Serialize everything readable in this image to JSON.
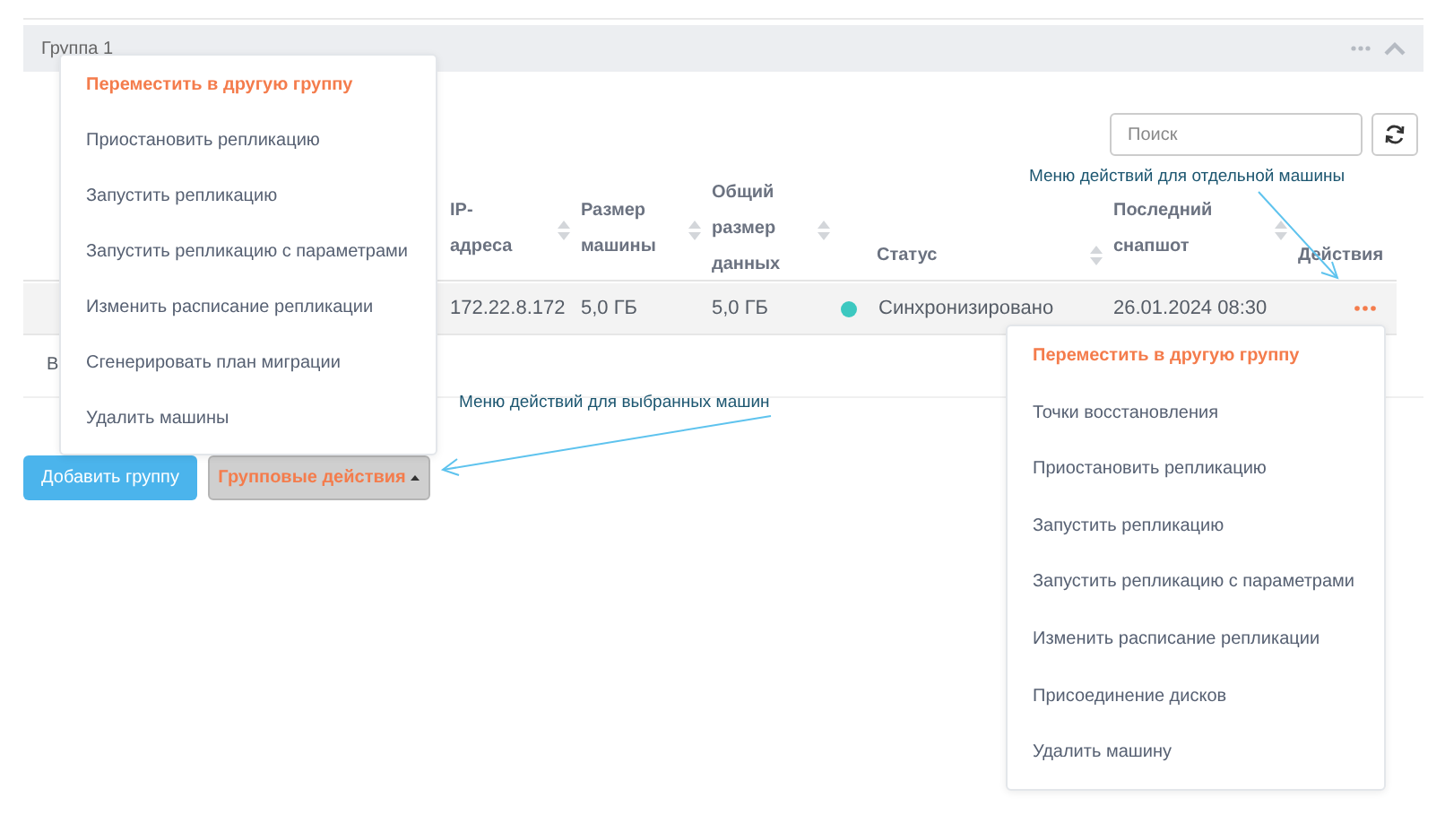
{
  "group": {
    "title": "Группа 1"
  },
  "search": {
    "placeholder": "Поиск"
  },
  "table": {
    "columns": [
      {
        "label": "IP-адреса",
        "sortable": true
      },
      {
        "label": "Размер машины",
        "sortable": true
      },
      {
        "label": "Общий размер данных",
        "sortable": true
      },
      {
        "label": "Статус",
        "sortable": true
      },
      {
        "label": "Последний снапшот",
        "sortable": true
      },
      {
        "label": "Действия",
        "sortable": false
      }
    ],
    "rows": [
      {
        "ip": "172.22.8.172",
        "size": "5,0 ГБ",
        "total": "5,0 ГБ",
        "status": "Синхронизировано",
        "color": "#3cc8c0",
        "snapshot": "26.01.2024 08:30"
      }
    ]
  },
  "below_text": "В",
  "buttons": {
    "add_group": "Добавить группу",
    "group_actions": "Групповые действия"
  },
  "group_actions_menu": [
    {
      "label": "Переместить в другую группу",
      "selected": true
    },
    {
      "label": "Приостановить репликацию",
      "selected": false
    },
    {
      "label": "Запустить репликацию",
      "selected": false
    },
    {
      "label": "Запустить репликацию с параметрами",
      "selected": false
    },
    {
      "label": "Изменить расписание репликации",
      "selected": false
    },
    {
      "label": "Сгенерировать план миграции",
      "selected": false
    },
    {
      "label": "Удалить машины",
      "selected": false
    }
  ],
  "row_actions_menu": [
    {
      "label": "Переместить в другую группу",
      "selected": true
    },
    {
      "label": "Точки восстановления",
      "selected": false
    },
    {
      "label": "Приостановить репликацию",
      "selected": false
    },
    {
      "label": "Запустить репликацию",
      "selected": false
    },
    {
      "label": "Запустить репликацию с параметрами",
      "selected": false
    },
    {
      "label": "Изменить расписание репликации",
      "selected": false
    },
    {
      "label": "Присоединение дисков",
      "selected": false
    },
    {
      "label": "Удалить машину",
      "selected": false
    }
  ],
  "annotations": [
    {
      "text": "Меню действий для отдельной машины"
    },
    {
      "text": "Меню действий для выбранных машин"
    }
  ]
}
